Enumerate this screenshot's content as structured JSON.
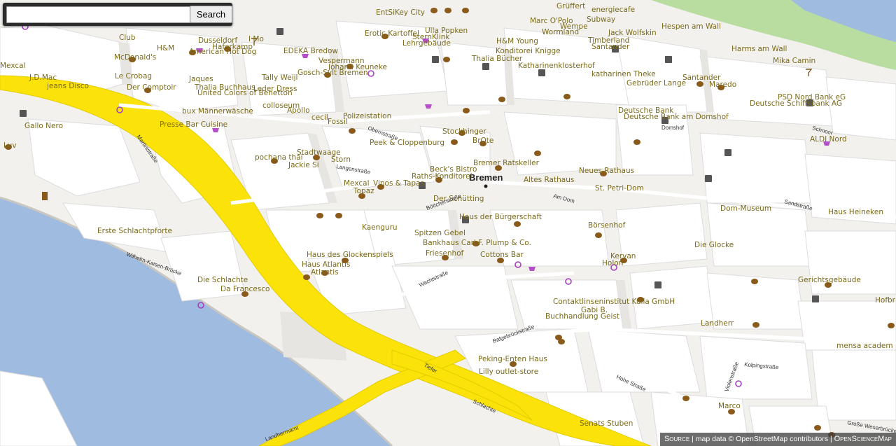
{
  "search": {
    "placeholder": "",
    "value": "",
    "button_label": "Search"
  },
  "map": {
    "city_label": "Bremen",
    "colors": {
      "water": "#9fbbe0",
      "motorway": "#fbe30a",
      "park": "#b9dca0",
      "ground": "#f2f1ee",
      "building": "#ffffff",
      "poi_text": "#7a6a1a"
    },
    "poi_labels": [
      "EntSiKey City",
      "energiecafe",
      "Grüffert",
      "Subway",
      "Hespen am Wall",
      "Marc O'Polo",
      "Wempe",
      "Wormland",
      "Jack Wolfskin",
      "Timberland",
      "Santander",
      "Erotic Kartoffel",
      "Ulla Popken",
      "SternKlink",
      "Lehrgebäude",
      "H&M Young",
      "Konditorei Knigge",
      "Thalia Bücher",
      "Katharinenklosterhof",
      "Harms am Wall",
      "Mika Camin",
      "Club",
      "Dusseldorf",
      "I Mo",
      "Haferkamp",
      "H&M",
      "American Hot Dog",
      "EDEKA Bredow",
      "McDonald's",
      "Vespermann",
      "Johann Keuneke",
      "Gosch-Sylt Bremen",
      "Mexcal",
      "J.D.Mac",
      "Le Crobag",
      "Jaques",
      "Tally Weijl",
      "Thalia Buchhaus",
      "Leder Dress",
      "United Colors of Benetton",
      "colloseum",
      "jeans Disco",
      "Der Comptoir",
      "bux Männerwäsche",
      "Apollo",
      "cecil",
      "Fossil",
      "Polizeistation",
      "Gallo Nero",
      "Presse Bar Cuisine",
      "Stockhinger",
      "BrOte",
      "Peek & Cloppenburg",
      "Luv",
      "katharinen Theke",
      "Gebrüder Lange",
      "Santander",
      "Maredo",
      "Deutsche Bank",
      "Deutsche Bank am Domshof",
      "PSD Nord Bank eG",
      "Deutsche Schiffsbank AG",
      "ALDI Nord",
      "pochana thai",
      "Stadtwaage",
      "Jackie Si",
      "Storn",
      "Beck's Bistro",
      "Raths-Konditorei",
      "Bremer Ratskeller",
      "Altes Rathaus",
      "Neues Rathaus",
      "Vinos & Tapas",
      "Topaz",
      "Mexcal",
      "Der Schütting",
      "St. Petri-Dom",
      "Dom-Museum",
      "Haus Heineken",
      "Kaenguru",
      "Haus der Bürgerschaft",
      "Spitzen Gebel",
      "Bankhaus Carl F. Plump & Co.",
      "Friesenhof",
      "Cottons Bar",
      "Börsenhof",
      "Die Glocke",
      "Erste Schlachtpforte",
      "Haus des Glockenspiels",
      "Haus Atlantis",
      "Atlantis",
      "Kervan",
      "Holon",
      "Die Schlachte",
      "Da Francesco",
      "Gerichtsgebäude",
      "Contaktlinseninstitut Kulla GmbH",
      "Gabi B.",
      "Buchhandlung Geist",
      "Landherr",
      "Hofbr",
      "mensa academ",
      "Peking-Enten Haus",
      "Lilly outlet-store",
      "Marco",
      "Senats Stuben"
    ],
    "street_labels": [
      "Martinistraße",
      "Langenstraße",
      "Obernstraße",
      "Böttcherstraße",
      "Wachtstraße",
      "Balgebrückstraße",
      "Domshof",
      "Am Dom",
      "Sandstraße",
      "Kolpingstraße",
      "Hohe Straße",
      "Tiefer",
      "Schlachte",
      "Wilhelm-Kaisen-Brücke",
      "Landherrnamt",
      "Violenstraße",
      "Schnoor",
      "Große Weserbrücke"
    ]
  },
  "attribution": {
    "source_label": "Source",
    "text": "map data © OpenStreetMap contributors",
    "org": "OpenScienceMap"
  }
}
